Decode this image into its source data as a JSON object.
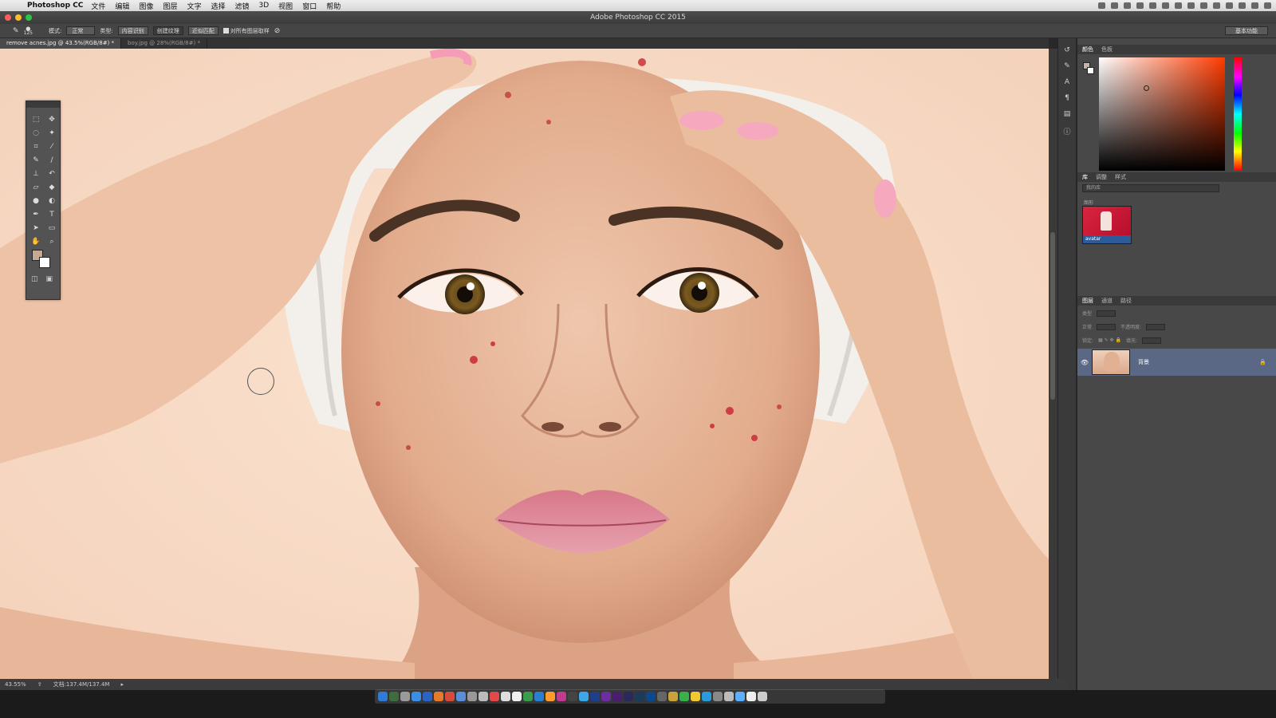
{
  "menubar": {
    "app_name": "Photoshop CC",
    "items": [
      "文件",
      "编辑",
      "图像",
      "图层",
      "文字",
      "选择",
      "滤镜",
      "3D",
      "视图",
      "窗口",
      "帮助"
    ]
  },
  "window": {
    "title": "Adobe Photoshop CC 2015"
  },
  "options_bar": {
    "brush_size": "125",
    "mode_label": "模式:",
    "mode_value": "正常",
    "type_label": "类型:",
    "type_options": [
      "内容识别",
      "创建纹理",
      "近似匹配"
    ],
    "sample_all_label": "对所有图层取样",
    "workspace": "基本功能"
  },
  "tabs": [
    {
      "label": "remove acnes.jpg @ 43.5%(RGB/8#) *",
      "active": true
    },
    {
      "label": "boy.jpg @ 28%(RGB/8#) *",
      "active": false
    }
  ],
  "status_bar": {
    "zoom": "43.55%",
    "doc_info": "文档:137.4M/137.4M"
  },
  "panels": {
    "color_tabs": [
      "颜色",
      "色板"
    ],
    "library_tabs": [
      "库",
      "调整",
      "样式"
    ],
    "library_select": "我的库",
    "library_group": "图形",
    "library_item": "avatar",
    "layers_tabs": [
      "图层",
      "通道",
      "路径"
    ],
    "layer_kind": "类型",
    "blend_mode": "正常",
    "opacity_label": "不透明度:",
    "lock_label": "锁定:",
    "fill_label": "填充:",
    "layers": [
      {
        "name": "背景",
        "visible": true,
        "locked": true
      }
    ]
  },
  "colors": {
    "foreground": "#c4a898",
    "background": "#ffffff",
    "selected_layer": "#5a6886"
  }
}
